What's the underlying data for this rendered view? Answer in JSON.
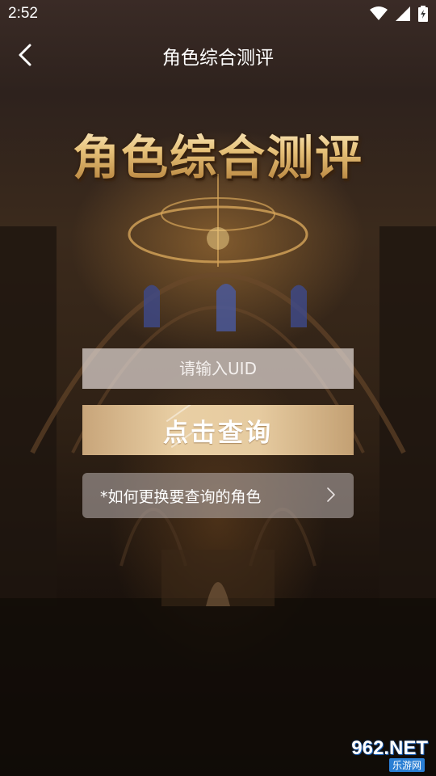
{
  "status_bar": {
    "time": "2:52"
  },
  "header": {
    "title": "角色综合测评"
  },
  "hero": {
    "title": "角色综合测评"
  },
  "form": {
    "uid_placeholder": "请输入UID",
    "query_button": "点击查询",
    "help_link": "*如何更换要查询的角色"
  },
  "watermark": {
    "brand": "962.NET",
    "sub": "乐游网"
  },
  "colors": {
    "button_gold": "#e3c79c",
    "input_bg": "#d8cdc8",
    "hero_gold": "#e7c27a"
  },
  "icons": {
    "back": "chevron-left-icon",
    "wifi": "wifi-icon",
    "signal": "signal-icon",
    "battery": "battery-icon",
    "help_arrow": "chevron-right-icon"
  }
}
